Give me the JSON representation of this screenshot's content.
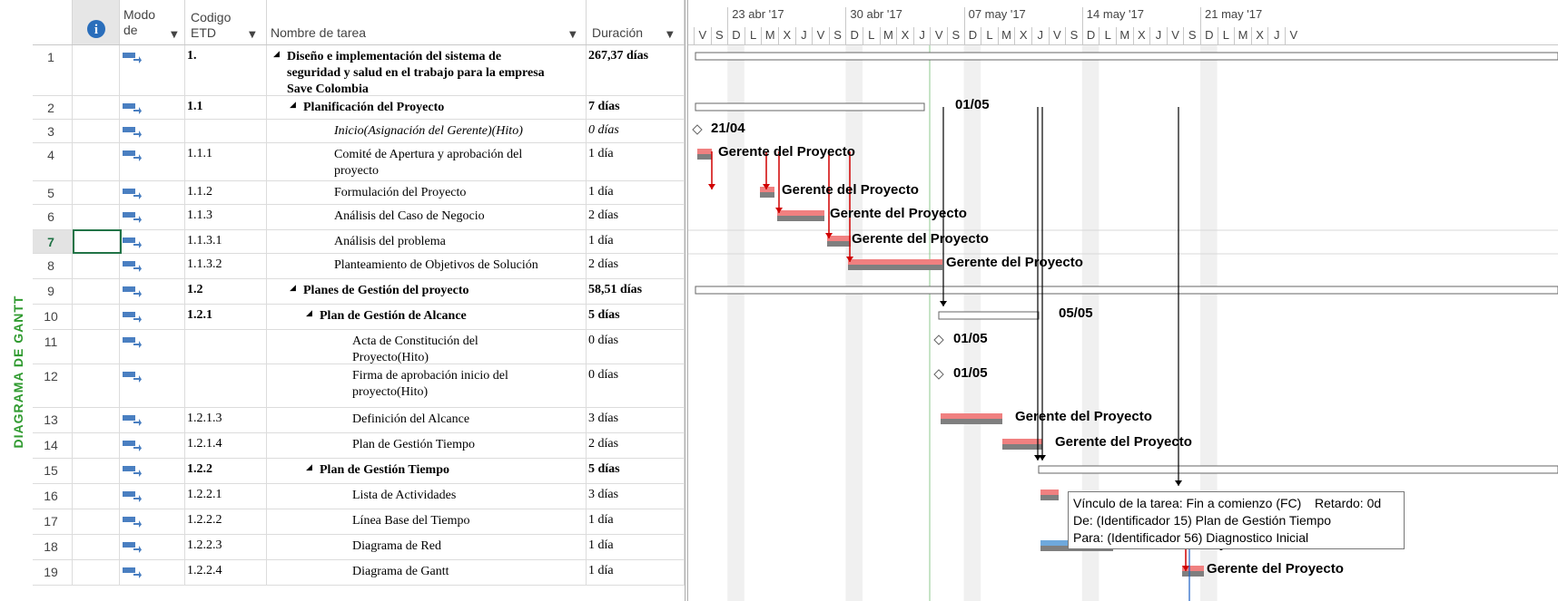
{
  "side_label": "DIAGRAMA DE GANTT",
  "columns": {
    "info_icon": "info-icon",
    "mode": "Modo de",
    "wbs": "Codigo ETD",
    "wbs_line1": "Codigo",
    "wbs_line2": "ETD",
    "name": "Nombre de tarea",
    "duration": "Duración",
    "mode_line1": "Modo",
    "mode_line2": "de"
  },
  "timescale": {
    "weeks": [
      "23 abr '17",
      "30 abr '17",
      "07 may '17",
      "14 may '17",
      "21 may '17"
    ],
    "days": [
      "V",
      "S",
      "D",
      "L",
      "M",
      "X",
      "J",
      "V",
      "S",
      "D",
      "L",
      "M",
      "X",
      "J",
      "V",
      "S",
      "D",
      "L",
      "M",
      "X",
      "J",
      "V",
      "S",
      "D",
      "L",
      "M",
      "X",
      "J",
      "V",
      "S",
      "D",
      "L",
      "M",
      "X",
      "J",
      "V"
    ]
  },
  "rows": [
    {
      "id": "1",
      "wbs": "1.",
      "name_lines": [
        "Diseño e implementación del sistema de",
        "seguridad y salud en el trabajo para la empresa",
        "Save Colombia"
      ],
      "duration": "267,37 días",
      "style": "summary",
      "indent": 0
    },
    {
      "id": "2",
      "wbs": "1.1",
      "name_lines": [
        "Planificación del Proyecto"
      ],
      "duration": "7 días",
      "style": "summary",
      "indent": 1
    },
    {
      "id": "3",
      "wbs": "",
      "name_lines": [
        "Inicio(Asignación del Gerente)(Hito)"
      ],
      "duration": "0 días",
      "style": "milestone",
      "indent": 2
    },
    {
      "id": "4",
      "wbs": "1.1.1",
      "name_lines": [
        "Comité de Apertura y aprobación del",
        "proyecto"
      ],
      "duration": "1 día",
      "style": "task",
      "indent": 2
    },
    {
      "id": "5",
      "wbs": "1.1.2",
      "name_lines": [
        "Formulación del Proyecto"
      ],
      "duration": "1 día",
      "style": "task",
      "indent": 2
    },
    {
      "id": "6",
      "wbs": "1.1.3",
      "name_lines": [
        "Análisis del Caso de Negocio"
      ],
      "duration": "2 días",
      "style": "task",
      "indent": 2
    },
    {
      "id": "7",
      "wbs": "1.1.3.1",
      "name_lines": [
        "Análisis del problema"
      ],
      "duration": "1 día",
      "style": "task",
      "indent": 2
    },
    {
      "id": "8",
      "wbs": "1.1.3.2",
      "name_lines": [
        "Planteamiento de Objetivos de Solución"
      ],
      "duration": "2 días",
      "style": "task",
      "indent": 2
    },
    {
      "id": "9",
      "wbs": "1.2",
      "name_lines": [
        "Planes de Gestión del proyecto"
      ],
      "duration": "58,51 días",
      "style": "summary",
      "indent": 1
    },
    {
      "id": "10",
      "wbs": "1.2.1",
      "name_lines": [
        "Plan de Gestión de Alcance"
      ],
      "duration": "5 días",
      "style": "summary",
      "indent": 2
    },
    {
      "id": "11",
      "wbs": "",
      "name_lines": [
        "Acta de Constitución del",
        "Proyecto(Hito)"
      ],
      "duration": "0 días",
      "style": "task",
      "indent": 3
    },
    {
      "id": "12",
      "wbs": "",
      "name_lines": [
        "Firma de aprobación inicio del",
        "proyecto(Hito)"
      ],
      "duration": "0 días",
      "style": "task",
      "indent": 3
    },
    {
      "id": "13",
      "wbs": "1.2.1.3",
      "name_lines": [
        "Definición del Alcance"
      ],
      "duration": "3 días",
      "style": "task",
      "indent": 3
    },
    {
      "id": "14",
      "wbs": "1.2.1.4",
      "name_lines": [
        "Plan de Gestión Tiempo"
      ],
      "duration": "2 días",
      "style": "task",
      "indent": 3
    },
    {
      "id": "15",
      "wbs": "1.2.2",
      "name_lines": [
        "Plan de Gestión Tiempo"
      ],
      "duration": "5 días",
      "style": "summary",
      "indent": 2
    },
    {
      "id": "16",
      "wbs": "1.2.2.1",
      "name_lines": [
        "Lista de Actividades"
      ],
      "duration": "3 días",
      "style": "task",
      "indent": 3
    },
    {
      "id": "17",
      "wbs": "1.2.2.2",
      "name_lines": [
        "Línea Base del Tiempo"
      ],
      "duration": "1 día",
      "style": "task",
      "indent": 3
    },
    {
      "id": "18",
      "wbs": "1.2.2.3",
      "name_lines": [
        "Diagrama de Red"
      ],
      "duration": "1 día",
      "style": "task",
      "indent": 3
    },
    {
      "id": "19",
      "wbs": "1.2.2.4",
      "name_lines": [
        "Diagrama de Gantt"
      ],
      "duration": "1 día",
      "style": "task",
      "indent": 3
    }
  ],
  "gantt_labels": {
    "r2": "01/05",
    "r3": "21/04",
    "r4": "Gerente del Proyecto",
    "r5": "Gerente del Proyecto",
    "r6": "Gerente del Proyecto",
    "r7": "Gerente del Proyecto",
    "r8": "Gerente del Proyecto",
    "r10": "05/05",
    "r11": "01/05",
    "r12": "01/05",
    "r13": "Gerente del Proyecto",
    "r14": "Gerente del Proyecto",
    "r18": "Gerente del Proyecto",
    "r19": "Gerente del Proyecto"
  },
  "tooltip": {
    "line1": "Vínculo de la tarea: Fin a comienzo (FC)",
    "line1b": "Retardo: 0d",
    "line2": "De: (Identificador 15) Plan de Gestión Tiempo",
    "line3": "Para: (Identificador 56) Diagnostico Inicial"
  },
  "selected_row": "7",
  "colors": {
    "accent_green": "#2f9a2f",
    "task_bar": "#f08080",
    "baseline": "#7f7f7f",
    "link": "#d00000",
    "selected": "#217346",
    "progress_blue": "#6fa8dc"
  }
}
